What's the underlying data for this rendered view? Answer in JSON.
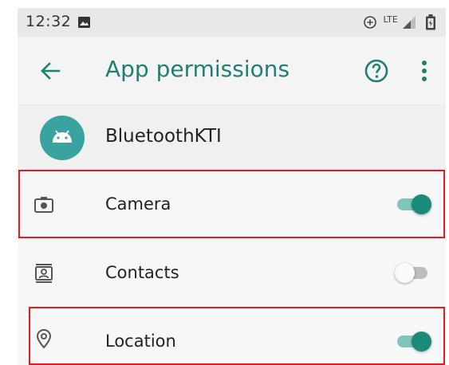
{
  "status_bar": {
    "time": "12:32",
    "network_label": "LTE"
  },
  "toolbar": {
    "title": "App permissions"
  },
  "app": {
    "name": "BluetoothKTI"
  },
  "permissions": [
    {
      "label": "Camera",
      "icon": "camera-icon",
      "enabled": true
    },
    {
      "label": "Contacts",
      "icon": "contacts-icon",
      "enabled": false
    },
    {
      "label": "Location",
      "icon": "location-icon",
      "enabled": true
    }
  ],
  "colors": {
    "accent": "#1e7f73",
    "toggle_on_thumb": "#1a8a79",
    "toggle_on_track": "#80c4bb",
    "highlight": "#e01b24",
    "app_icon_bg": "#3aa3a0"
  }
}
